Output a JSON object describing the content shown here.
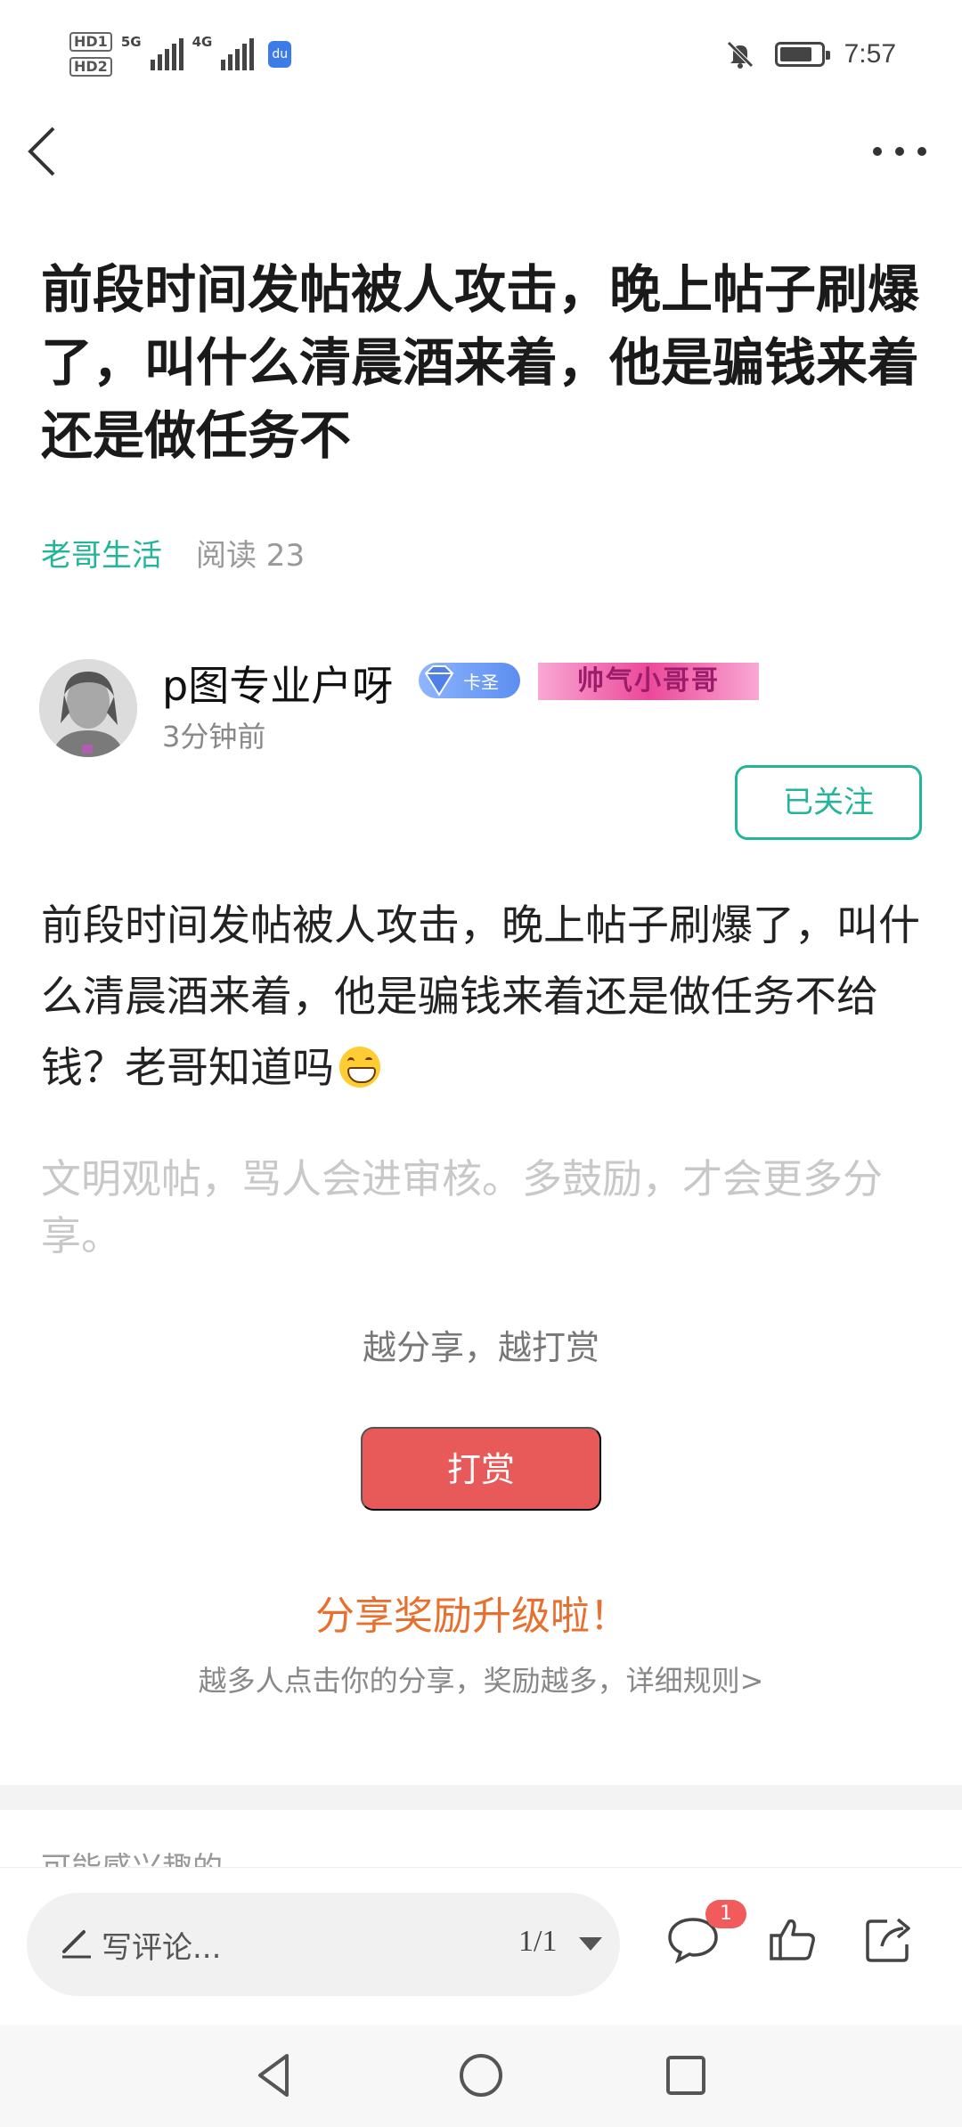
{
  "status_bar": {
    "sim1": "HD1",
    "sim2": "HD2",
    "net1": "5G",
    "net2": "4G",
    "time": "7:57"
  },
  "post": {
    "title": "前段时间发帖被人攻击，晚上帖子刷爆了，叫什么清晨酒来着，他是骗钱来着还是做任务不",
    "forum": "老哥生活",
    "reads": "阅读 23",
    "body": "前段时间发帖被人攻击，晚上帖子刷爆了，叫什么清晨酒来着，他是骗钱来着还是做任务不给钱？老哥知道吗",
    "emoji": "grinning-face"
  },
  "author": {
    "name": "p图专业户呀",
    "level_badge": "卡圣",
    "title_badge": "帅气小哥哥",
    "time": "3分钟前",
    "follow_label": "已关注"
  },
  "civil_note": "文明观帖，骂人会进审核。多鼓励，才会更多分享。",
  "reward": {
    "hint": "越分享，越打赏",
    "button": "打赏"
  },
  "share_bonus": {
    "title": "分享奖励升级啦！",
    "rule": "越多人点击你的分享，奖励越多，详细规则>"
  },
  "recommend": {
    "label": "可能感兴趣的"
  },
  "action_bar": {
    "comment_placeholder": "写评论...",
    "page_indicator": "1/1",
    "comment_badge": "1"
  },
  "colors": {
    "accent_green": "#23b59a",
    "reward_red": "#e85a5a",
    "share_orange": "#e8702f"
  }
}
